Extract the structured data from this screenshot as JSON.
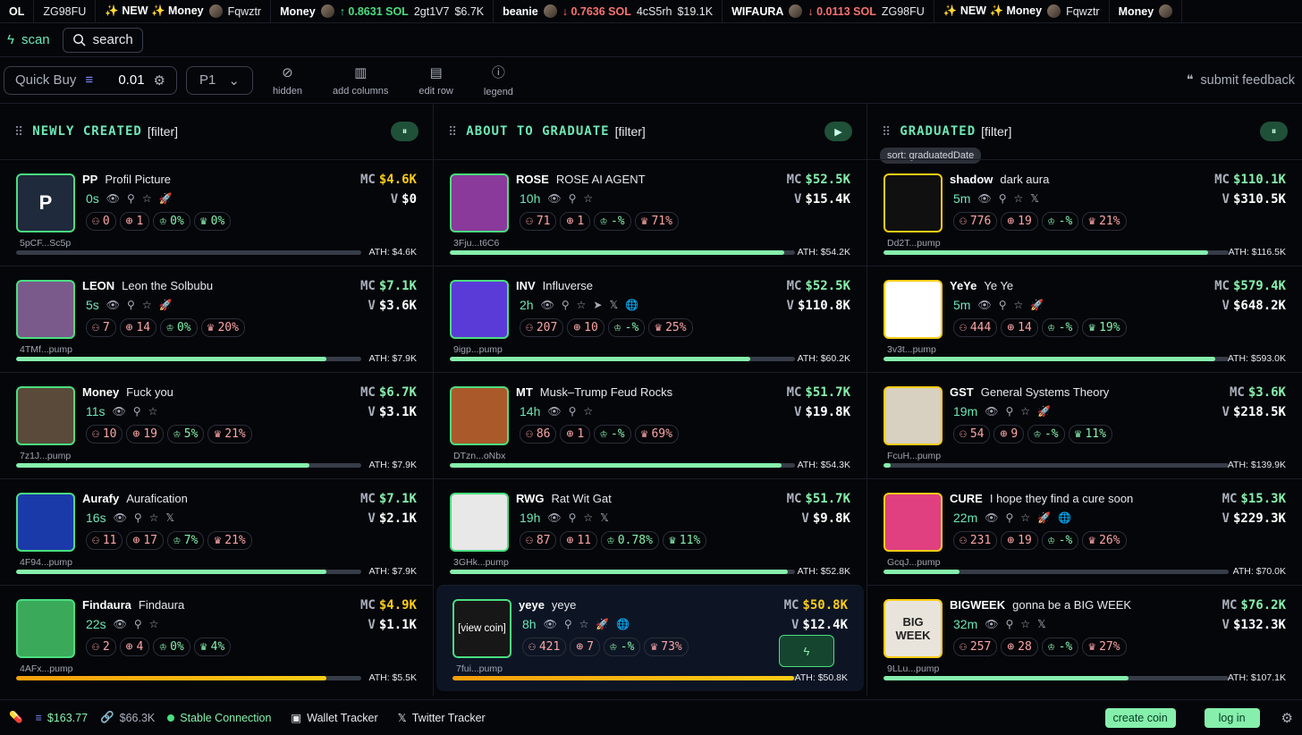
{
  "ticker": [
    {
      "name": "OL",
      "extra": ""
    },
    {
      "name": "",
      "extra": "ZG98FU"
    },
    {
      "name": "✨ NEW ✨ Money",
      "extra": "Fqwztr",
      "avatar": true
    },
    {
      "name": "Money",
      "change": "↑ 0.8631 SOL",
      "dir": "up",
      "id": "2gt1V7",
      "mc": "$6.7K",
      "avatar": true
    },
    {
      "name": "beanie",
      "change": "↓ 0.7636 SOL",
      "dir": "dn",
      "id": "4cS5rh",
      "mc": "$19.1K",
      "avatar": true
    },
    {
      "name": "WIFAURA",
      "change": "↓ 0.0113 SOL",
      "dir": "dn",
      "id": "ZG98FU",
      "mc": "",
      "avatar": true
    },
    {
      "name": "✨ NEW ✨ Money",
      "extra": "Fqwztr",
      "avatar": true
    },
    {
      "name": "Money",
      "avatar": true
    }
  ],
  "nav": {
    "scan": "scan",
    "search": "search"
  },
  "toolbar": {
    "quick_buy": "Quick Buy",
    "amount": "0.01",
    "preset": "P1",
    "hidden": "hidden",
    "add_columns": "add columns",
    "edit_row": "edit row",
    "legend": "legend",
    "feedback": "submit feedback"
  },
  "columns": [
    {
      "title": "NEWLY CREATED",
      "filter": "[filter]",
      "btn": "⏸",
      "sort": "",
      "rows": [
        {
          "tick": "PP",
          "full": "Profil Picture",
          "age": "0s",
          "icons": [
            "👁",
            "⚲",
            "☆",
            "🚀"
          ],
          "holders": "0",
          "snipers": "1",
          "dev": "0%",
          "top": "0%",
          "mc": "$4.6K",
          "mc_color": "#facc15",
          "vol": "$0",
          "ath": "ATH: $4.6K",
          "prog": 0.0,
          "addr": "5pCF...Sc5p",
          "letter": "P",
          "bg": "#1f2a3c"
        },
        {
          "tick": "LEON",
          "full": "Leon the Solbubu",
          "age": "5s",
          "icons": [
            "👁",
            "⚲",
            "☆",
            "🚀"
          ],
          "holders": "7",
          "snipers": "14",
          "dev": "0%",
          "top": "20%",
          "mc": "$7.1K",
          "mc_color": "#86efac",
          "vol": "$3.6K",
          "ath": "ATH: $7.9K",
          "prog": 0.9,
          "addr": "4TMf...pump",
          "letter": "",
          "bg": "#7a5a8a"
        },
        {
          "tick": "Money",
          "full": "Fuck you",
          "age": "11s",
          "icons": [
            "👁",
            "⚲",
            "☆"
          ],
          "holders": "10",
          "snipers": "19",
          "dev": "5%",
          "top": "21%",
          "mc": "$6.7K",
          "mc_color": "#86efac",
          "vol": "$3.1K",
          "ath": "ATH: $7.9K",
          "prog": 0.85,
          "addr": "7z1J...pump",
          "letter": "",
          "bg": "#5a4a3a"
        },
        {
          "tick": "Aurafy",
          "full": "Aurafication",
          "age": "16s",
          "icons": [
            "👁",
            "⚲",
            "☆",
            "𝕏"
          ],
          "holders": "11",
          "snipers": "17",
          "dev": "7%",
          "top": "21%",
          "mc": "$7.1K",
          "mc_color": "#86efac",
          "vol": "$2.1K",
          "ath": "ATH: $7.9K",
          "prog": 0.9,
          "addr": "4F94...pump",
          "letter": "",
          "bg": "#1a3aaa"
        },
        {
          "tick": "Findaura",
          "full": "Findaura",
          "age": "22s",
          "icons": [
            "👁",
            "⚲",
            "☆"
          ],
          "holders": "2",
          "snipers": "4",
          "dev": "0%",
          "top": "4%",
          "mc": "$4.9K",
          "mc_color": "#facc15",
          "vol": "$1.1K",
          "ath": "ATH: $5.5K",
          "prog": 0.9,
          "orange": true,
          "addr": "4AFx...pump",
          "letter": "",
          "bg": "#3aaa5a"
        }
      ]
    },
    {
      "title": "ABOUT TO GRADUATE",
      "filter": "[filter]",
      "btn": "▶",
      "sort": "",
      "rows": [
        {
          "tick": "ROSE",
          "full": "ROSE AI AGENT",
          "age": "10h",
          "icons": [
            "👁",
            "⚲",
            "☆"
          ],
          "holders": "71",
          "snipers": "1",
          "dev": "-%",
          "top": "71%",
          "mc": "$52.5K",
          "mc_color": "#86efac",
          "vol": "$15.4K",
          "ath": "ATH: $54.2K",
          "prog": 0.97,
          "addr": "3Fju...t6C6",
          "letter": "",
          "bg": "#8a3a9a"
        },
        {
          "tick": "INV",
          "full": "Influverse",
          "age": "2h",
          "icons": [
            "👁",
            "⚲",
            "☆",
            "➤",
            "𝕏",
            "🌐"
          ],
          "holders": "207",
          "snipers": "10",
          "dev": "-%",
          "top": "25%",
          "mc": "$52.5K",
          "mc_color": "#86efac",
          "vol": "$110.8K",
          "ath": "ATH: $60.2K",
          "prog": 0.87,
          "addr": "9igp...pump",
          "letter": "",
          "bg": "#5b3bd8"
        },
        {
          "tick": "MT",
          "full": "Musk–Trump Feud Rocks",
          "age": "14h",
          "icons": [
            "👁",
            "⚲",
            "☆"
          ],
          "holders": "86",
          "snipers": "1",
          "dev": "-%",
          "top": "69%",
          "mc": "$51.7K",
          "mc_color": "#86efac",
          "vol": "$19.8K",
          "ath": "ATH: $54.3K",
          "prog": 0.96,
          "addr": "DTzn...oNbx",
          "letter": "",
          "bg": "#aa5a2a"
        },
        {
          "tick": "RWG",
          "full": "Rat Wit Gat",
          "age": "19h",
          "icons": [
            "👁",
            "⚲",
            "☆",
            "𝕏"
          ],
          "holders": "87",
          "snipers": "11",
          "dev": "0.78%",
          "top": "11%",
          "mc": "$51.7K",
          "mc_color": "#86efac",
          "vol": "$9.8K",
          "ath": "ATH: $52.8K",
          "prog": 0.98,
          "addr": "3GHk...pump",
          "letter": "",
          "bg": "#e8e8e8"
        },
        {
          "tick": "yeye",
          "full": "yeye",
          "age": "8h",
          "icons": [
            "👁",
            "⚲",
            "☆",
            "🚀",
            "🌐"
          ],
          "holders": "421",
          "snipers": "7",
          "dev": "-%",
          "top": "73%",
          "mc": "$50.8K",
          "mc_color": "#facc15",
          "vol": "$12.4K",
          "ath": "ATH: $50.8K",
          "prog": 0.99,
          "orange": true,
          "addr": "7fui...pump",
          "letter": "",
          "bg": "#2a2a2a",
          "view": "[view coin]",
          "hl": true
        }
      ]
    },
    {
      "title": "GRADUATED",
      "filter": "[filter]",
      "btn": "⏸",
      "sort": "sort: graduatedDate",
      "rows": [
        {
          "tick": "shadow",
          "full": "dark aura",
          "age": "5m",
          "icons": [
            "👁",
            "⚲",
            "☆",
            "𝕏"
          ],
          "holders": "776",
          "snipers": "19",
          "dev": "-%",
          "top": "21%",
          "mc": "$110.1K",
          "mc_color": "#86efac",
          "vol": "$310.5K",
          "ath": "ATH: $116.5K",
          "prog": 0.94,
          "addr": "Dd2T...pump",
          "letter": "",
          "bg": "#101010",
          "gold": true
        },
        {
          "tick": "YeYe",
          "full": "Ye Ye",
          "age": "5m",
          "icons": [
            "👁",
            "⚲",
            "☆",
            "🚀"
          ],
          "holders": "444",
          "snipers": "14",
          "dev": "-%",
          "top": "19%",
          "mc": "$579.4K",
          "mc_color": "#86efac",
          "vol": "$648.2K",
          "ath": "ATH: $593.0K",
          "prog": 0.96,
          "addr": "3v3t...pump",
          "letter": "",
          "bg": "#ffffff",
          "gold": true
        },
        {
          "tick": "GST",
          "full": "General Systems Theory",
          "age": "19m",
          "icons": [
            "👁",
            "⚲",
            "☆",
            "🚀"
          ],
          "holders": "54",
          "snipers": "9",
          "dev": "-%",
          "top": "11%",
          "mc": "$3.6K",
          "mc_color": "#86efac",
          "vol": "$218.5K",
          "ath": "ATH: $139.9K",
          "prog": 0.02,
          "addr": "FcuH...pump",
          "letter": "",
          "bg": "#d8d0c0",
          "gold": true
        },
        {
          "tick": "CURE",
          "full": "I hope they find a cure soon",
          "age": "22m",
          "icons": [
            "👁",
            "⚲",
            "☆",
            "🚀",
            "🌐"
          ],
          "holders": "231",
          "snipers": "19",
          "dev": "-%",
          "top": "26%",
          "mc": "$15.3K",
          "mc_color": "#86efac",
          "vol": "$229.3K",
          "ath": "ATH: $70.0K",
          "prog": 0.22,
          "addr": "GcqJ...pump",
          "letter": "",
          "bg": "#e04080",
          "gold": true
        },
        {
          "tick": "BIGWEEK",
          "full": "gonna be a BIG WEEK",
          "age": "32m",
          "icons": [
            "👁",
            "⚲",
            "☆",
            "𝕏"
          ],
          "holders": "257",
          "snipers": "28",
          "dev": "-%",
          "top": "27%",
          "mc": "$76.2K",
          "mc_color": "#86efac",
          "vol": "$132.3K",
          "ath": "ATH: $107.1K",
          "prog": 0.71,
          "addr": "9LLu...pump",
          "letter": "BIG WEEK",
          "bg": "#e8e4dc",
          "gold": true
        }
      ]
    }
  ],
  "footer": {
    "sol_price": "$163.77",
    "mc": "$66.3K",
    "connection": "Stable Connection",
    "wallet": "Wallet Tracker",
    "twitter": "Twitter Tracker",
    "create": "create coin",
    "login": "log in"
  }
}
